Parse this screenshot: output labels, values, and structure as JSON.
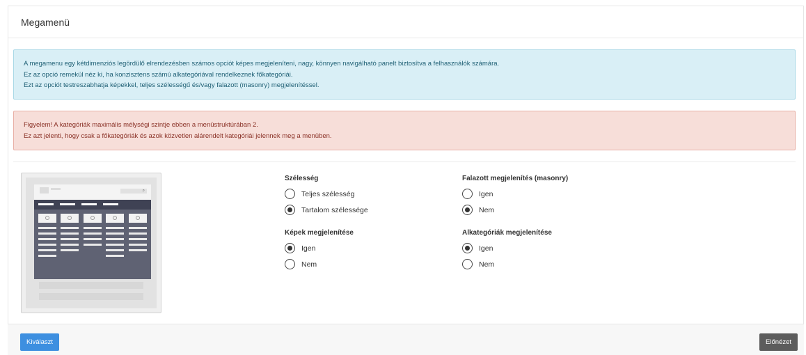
{
  "header": {
    "title": "Megamenü"
  },
  "info_alert": {
    "lines": [
      "A megamenu egy kétdimenziós legördülő elrendezésben számos opciót képes megjeleníteni, nagy, könnyen navigálható panelt biztosítva a felhasználók számára.",
      "Ez az opció remekül néz ki, ha konzisztens számú alkategóriával rendelkeznek főkategóriái.",
      "Ezt az opciót testreszabhatja képekkel, teljes szélességű és/vagy falazott (masonry) megjelenítéssel."
    ]
  },
  "warning_alert": {
    "lines": [
      "Figyelem! A kategóriák maximális mélységi szintje ebben a menüstruktúrában 2.",
      "Ez azt jelenti, hogy csak a főkategóriák és azok közvetlen alárendelt kategóriái jelennek meg a menüben."
    ]
  },
  "options": {
    "width": {
      "title": "Szélesség",
      "choices": [
        "Teljes szélesség",
        "Tartalom szélessége"
      ],
      "selected": 1
    },
    "images": {
      "title": "Képek megjelenítése",
      "choices": [
        "Igen",
        "Nem"
      ],
      "selected": 0
    },
    "masonry": {
      "title": "Falazott megjelenítés (masonry)",
      "choices": [
        "Igen",
        "Nem"
      ],
      "selected": 1
    },
    "subcategories": {
      "title": "Alkategóriák megjelenítése",
      "choices": [
        "Igen",
        "Nem"
      ],
      "selected": 0
    }
  },
  "footer": {
    "select_label": "Kiválaszt",
    "preview_label": "Előnézet"
  },
  "thumbnail": {
    "search_glyph": "⌕"
  },
  "colors": {
    "primary": "#3d8fe0",
    "secondary": "#5c5c5c",
    "info_bg": "#d9eff6",
    "warn_bg": "#f7ded9"
  }
}
